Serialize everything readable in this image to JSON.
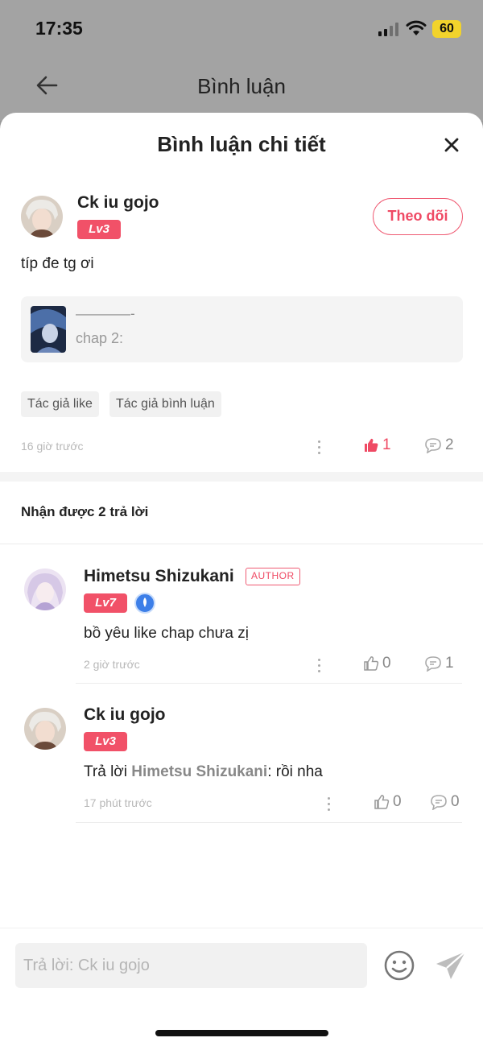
{
  "status_bar": {
    "time": "17:35",
    "battery": "60"
  },
  "nav": {
    "title": "Bình luận"
  },
  "sheet": {
    "title": "Bình luận chi tiết"
  },
  "main_comment": {
    "username": "Ck iu gojo",
    "level": "Lv3",
    "follow_label": "Theo dõi",
    "text": "típ đe tg ơi",
    "chapter_line": "————-",
    "chapter_name": "chap 2:",
    "tags": [
      "Tác giả like",
      "Tác giả bình luận"
    ],
    "time": "16 giờ trước",
    "likes": "1",
    "replies": "2"
  },
  "replies_header": "Nhận được 2 trả lời",
  "replies": [
    {
      "username": "Himetsu Shizukani",
      "author_tag": "AUTHOR",
      "level": "Lv7",
      "text": "bồ yêu like chap chưa zị",
      "time": "2 giờ trước",
      "likes": "0",
      "replies": "1"
    },
    {
      "username": "Ck iu gojo",
      "level": "Lv3",
      "reply_prefix": "Trả lời ",
      "reply_to": "Himetsu Shizukani",
      "text": ": rồi nha",
      "time": "17 phút trước",
      "likes": "0",
      "replies": "0"
    }
  ],
  "input": {
    "placeholder": "Trả lời: Ck iu gojo"
  },
  "colors": {
    "accent": "#ef4a64",
    "badge": "#f15168"
  }
}
